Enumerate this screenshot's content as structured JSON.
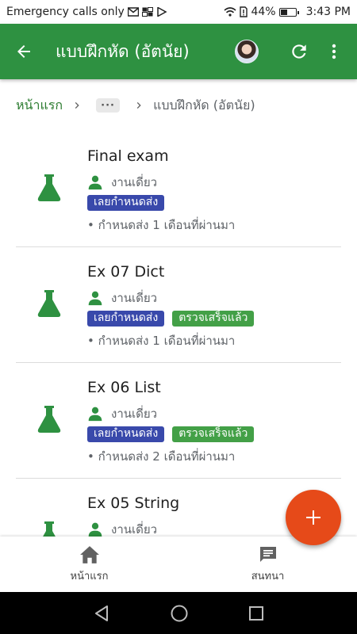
{
  "status_bar": {
    "left_text": "Emergency calls only",
    "battery": "44%",
    "time": "3:43 PM"
  },
  "app_bar": {
    "title": "แบบฝึกหัด (อัตนัย)",
    "background_color": "#2e9141"
  },
  "breadcrumb": {
    "home": "หน้าแรก",
    "ellipsis": "···",
    "current": "แบบฝึกหัด (อัตนัย)"
  },
  "assignments": [
    {
      "name": "Final exam",
      "type": "งานเดี่ยว",
      "late_badge": "เลยกำหนดส่ง",
      "graded_badge": "",
      "due": "• กำหนดส่ง 1 เดือนที่ผ่านมา"
    },
    {
      "name": "Ex 07 Dict",
      "type": "งานเดี่ยว",
      "late_badge": "เลยกำหนดส่ง",
      "graded_badge": "ตรวจเสร็จแล้ว",
      "due": "• กำหนดส่ง 1 เดือนที่ผ่านมา"
    },
    {
      "name": "Ex 06 List",
      "type": "งานเดี่ยว",
      "late_badge": "เลยกำหนดส่ง",
      "graded_badge": "ตรวจเสร็จแล้ว",
      "due": "• กำหนดส่ง 2 เดือนที่ผ่านมา"
    },
    {
      "name": "Ex 05 String",
      "type": "งานเดี่ยว",
      "late_badge": "",
      "graded_badge": "",
      "due": ""
    }
  ],
  "bottom_nav": {
    "home_label": "หน้าแรก",
    "chat_label": "สนทนา"
  },
  "icons": {
    "back": "arrow-left-icon",
    "refresh": "refresh-icon",
    "more": "more-vert-icon",
    "assignment": "flask-icon",
    "person": "person-icon",
    "fab": "plus-icon",
    "home": "home-icon",
    "chat": "chat-icon"
  },
  "colors": {
    "primary": "#2e9141",
    "late_badge": "#3949ab",
    "graded_badge": "#43a047",
    "fab": "#e64a19"
  }
}
